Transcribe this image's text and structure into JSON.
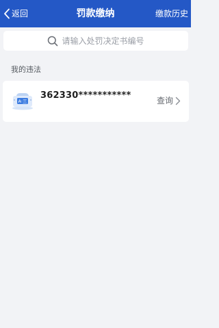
{
  "header": {
    "back_label": "返回",
    "title": "罚款缴纳",
    "history_label": "缴款历史"
  },
  "search": {
    "placeholder": "请输入处罚决定书编号"
  },
  "section": {
    "label": "我的违法"
  },
  "violation": {
    "plate_number": "362330***********",
    "action_label": "查询"
  },
  "colors": {
    "header_bg": "#2458c6",
    "page_bg": "#f2f3f6",
    "card_bg": "#ffffff",
    "icon_blue": "#3b7be0"
  },
  "icons": {
    "back": "chevron-left-icon",
    "search": "search-icon",
    "plate": "license-plate-icon",
    "arrow": "chevron-right-icon"
  }
}
